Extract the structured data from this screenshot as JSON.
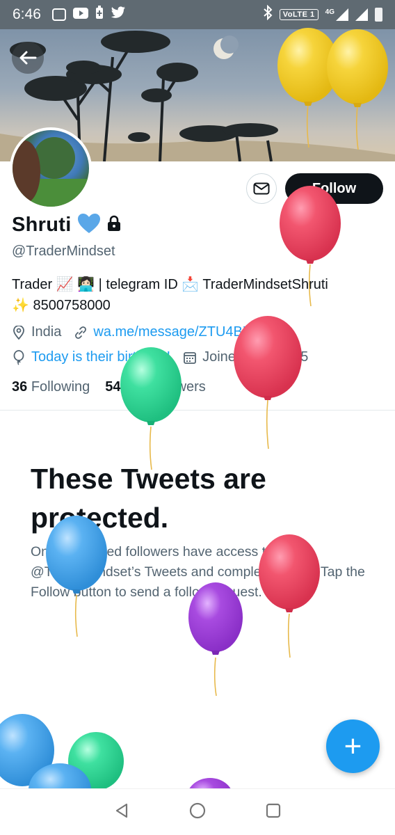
{
  "status_bar": {
    "time": "6:46",
    "network_label": "VoLTE 1",
    "network_type": "4G"
  },
  "profile": {
    "name": "Shruti",
    "handle": "@TraderMindset",
    "bio_line1": "Trader 📈 👩🏻‍💻 | telegram ID 📩 TraderMindsetShruti",
    "bio_line2": "✨  8500758000",
    "location": "India",
    "website": "wa.me/message/ZTU4BZ...",
    "birthday": "Today is their birthday!",
    "joined": "Joined May 2015",
    "following_count": "36",
    "following_label": "Following",
    "followers_count": "54.8K",
    "followers_label": "Followers"
  },
  "actions": {
    "follow_label": "Follow"
  },
  "protected": {
    "title": "These Tweets are protected.",
    "body": "Only confirmed followers have access to @TraderMindset’s Tweets and complete profile. Tap the Follow button to send a follow request."
  },
  "fab": {
    "label": "+"
  },
  "colors": {
    "accent": "#1d9bf0",
    "text_primary": "#0f1419",
    "text_secondary": "#536471",
    "status_bar": "#5f6a72"
  }
}
